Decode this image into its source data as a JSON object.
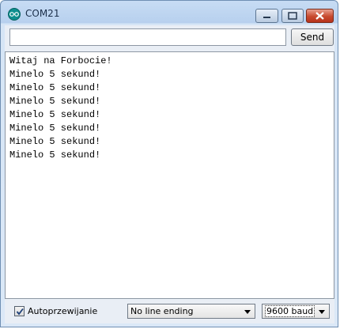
{
  "window": {
    "title": "COM21",
    "icon": "arduino-icon"
  },
  "toolbar": {
    "input_value": "",
    "send_label": "Send"
  },
  "output": {
    "lines": [
      "Witaj na Forbocie!",
      "Minelo 5 sekund!",
      "Minelo 5 sekund!",
      "Minelo 5 sekund!",
      "Minelo 5 sekund!",
      "Minelo 5 sekund!",
      "Minelo 5 sekund!",
      "Minelo 5 sekund!"
    ]
  },
  "footer": {
    "autoscroll_label": "Autoprzewijanie",
    "autoscroll_checked": true,
    "line_ending_selected": "No line ending",
    "baud_selected": "9600 baud"
  },
  "colors": {
    "close_button": "#c84a2f",
    "frame": "#b7d0ee",
    "app_icon": "#0e8f8f"
  }
}
